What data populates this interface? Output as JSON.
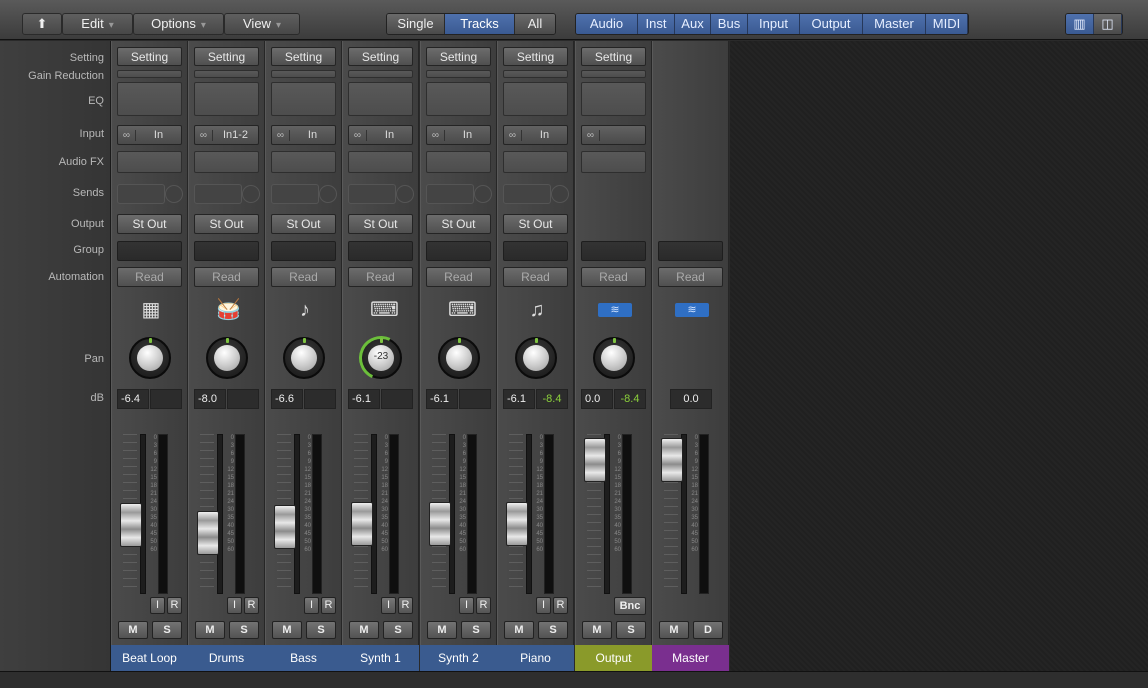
{
  "toolbar": {
    "back_icon": "up-arrow-icon",
    "menus": [
      "Edit",
      "Options",
      "View"
    ],
    "view_modes": [
      "Single",
      "Tracks",
      "All"
    ],
    "active_view_mode": "Tracks",
    "filters": [
      "Audio",
      "Inst",
      "Aux",
      "Bus",
      "Input",
      "Output",
      "Master",
      "MIDI"
    ],
    "layout_icons": [
      "wide-channel-icon",
      "narrow-channel-icon"
    ]
  },
  "row_labels": {
    "setting": "Setting",
    "gain_reduction": "Gain Reduction",
    "eq": "EQ",
    "input": "Input",
    "audio_fx": "Audio FX",
    "sends": "Sends",
    "output": "Output",
    "group": "Group",
    "automation": "Automation",
    "pan": "Pan",
    "db": "dB"
  },
  "channels": [
    {
      "name": "Beat Loop",
      "setting": "Setting",
      "input": "In",
      "output": "St Out",
      "automation": "Read",
      "icon": "drum-machine-icon",
      "pan": "",
      "volume": "-6.4",
      "peak": "",
      "color": "#3a5b8f",
      "fader": 0.57,
      "buttons": [
        "I",
        "R"
      ],
      "ms": [
        "M",
        "S"
      ]
    },
    {
      "name": "Drums",
      "setting": "Setting",
      "input": "In1-2",
      "output": "St Out",
      "automation": "Read",
      "icon": "drum-kit-icon",
      "pan": "",
      "volume": "-8.0",
      "peak": "",
      "color": "#3a5b8f",
      "fader": 0.62,
      "buttons": [
        "I",
        "R"
      ],
      "ms": [
        "M",
        "S"
      ]
    },
    {
      "name": "Bass",
      "setting": "Setting",
      "input": "In",
      "output": "St Out",
      "automation": "Read",
      "icon": "bass-guitar-icon",
      "pan": "",
      "volume": "-6.6",
      "peak": "",
      "color": "#3a5b8f",
      "fader": 0.58,
      "buttons": [
        "I",
        "R"
      ],
      "ms": [
        "M",
        "S"
      ]
    },
    {
      "name": "Synth 1",
      "setting": "Setting",
      "input": "In",
      "output": "St Out",
      "automation": "Read",
      "icon": "keyboard-stand-icon",
      "pan": "-23",
      "volume": "-6.1",
      "peak": "",
      "color": "#3a5b8f",
      "fader": 0.56,
      "buttons": [
        "I",
        "R"
      ],
      "ms": [
        "M",
        "S"
      ]
    },
    {
      "name": "Synth 2",
      "setting": "Setting",
      "input": "In",
      "output": "St Out",
      "automation": "Read",
      "icon": "keyboard-stand-icon",
      "pan": "",
      "volume": "-6.1",
      "peak": "",
      "color": "#3a5b8f",
      "fader": 0.56,
      "buttons": [
        "I",
        "R"
      ],
      "ms": [
        "M",
        "S"
      ]
    },
    {
      "name": "Piano",
      "setting": "Setting",
      "input": "In",
      "output": "St Out",
      "automation": "Read",
      "icon": "grand-piano-icon",
      "pan": "",
      "volume": "-6.1",
      "peak": "-8.4",
      "color": "#3a5b8f",
      "fader": 0.56,
      "buttons": [
        "I",
        "R"
      ],
      "ms": [
        "M",
        "S"
      ]
    },
    {
      "name": "Output",
      "setting": "Setting",
      "input": "",
      "output": "",
      "automation": "Read",
      "icon": "waveform-icon",
      "pan": "",
      "volume": "0.0",
      "peak": "-8.4",
      "color": "#8a9a2a",
      "fader": 0.16,
      "buttons": [
        "Bnc"
      ],
      "ms": [
        "M",
        "S"
      ]
    },
    {
      "name": "Master",
      "setting": "",
      "input": "",
      "output": "",
      "automation": "Read",
      "icon": "waveform-icon",
      "pan": "",
      "volume": "0.0",
      "peak": "",
      "color": "#7a2f8f",
      "fader": 0.16,
      "buttons": [],
      "ms": [
        "M",
        "D"
      ]
    }
  ],
  "meter_scale": [
    "0",
    "3",
    "6",
    "9",
    "12",
    "15",
    "18",
    "21",
    "24",
    "30",
    "35",
    "40",
    "45",
    "50",
    "60"
  ]
}
